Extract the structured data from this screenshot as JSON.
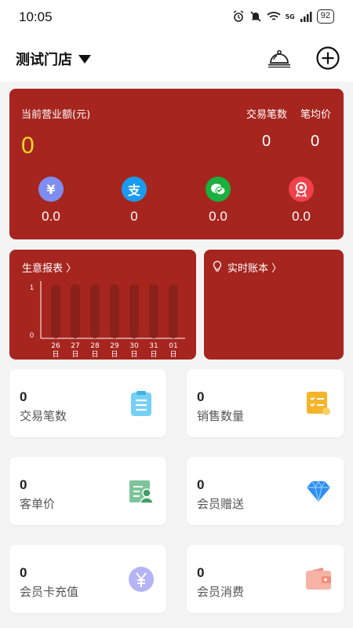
{
  "status_bar": {
    "time": "10:05",
    "network": "5G",
    "battery": "92"
  },
  "header": {
    "store_name": "测试门店"
  },
  "revenue": {
    "label": "当前营业额(元)",
    "value": "0",
    "transactions_label": "交易笔数",
    "transactions_value": "0",
    "avg_label": "笔均价",
    "avg_value": "0",
    "payments": [
      {
        "icon": "yuan-cash-icon",
        "symbol": "¥",
        "color": "#7e8df0",
        "value": "0.0"
      },
      {
        "icon": "alipay-icon",
        "symbol": "支",
        "color": "#1a9bf0",
        "value": "0"
      },
      {
        "icon": "wechat-pay-icon",
        "symbol": "",
        "color": "#19b03e",
        "value": "0.0"
      },
      {
        "icon": "badge-icon",
        "symbol": "",
        "color": "#f0414b",
        "value": "0.0"
      }
    ]
  },
  "report": {
    "title": "生意报表 〉"
  },
  "ledger": {
    "title": "实时账本 〉"
  },
  "chart_data": {
    "type": "bar",
    "categories": [
      "26\n日",
      "27\n日",
      "28\n日",
      "29\n日",
      "30\n日",
      "31\n日",
      "01\n日"
    ],
    "category_days": [
      "26",
      "27",
      "28",
      "29",
      "30",
      "31",
      "01"
    ],
    "category_unit": "日",
    "values": [
      0,
      0,
      0,
      0,
      0,
      0,
      0
    ],
    "yticks": [
      "1",
      "0"
    ],
    "ylim": [
      0,
      1
    ]
  },
  "stats": [
    {
      "value": "0",
      "label": "交易笔数",
      "icon": "list-doc-icon"
    },
    {
      "value": "0",
      "label": "销售数量",
      "icon": "checklist-icon"
    },
    {
      "value": "0",
      "label": "客单价",
      "icon": "customer-card-icon"
    },
    {
      "value": "0",
      "label": "会员赠送",
      "icon": "diamond-icon"
    },
    {
      "value": "0",
      "label": "会员卡充值",
      "icon": "yuan-coin-icon"
    },
    {
      "value": "0",
      "label": "会员消费",
      "icon": "wallet-icon"
    }
  ],
  "colors": {
    "card_red": "#a6261f",
    "revenue_yellow": "#f3d52b",
    "bar_dark": "#8a211b"
  }
}
